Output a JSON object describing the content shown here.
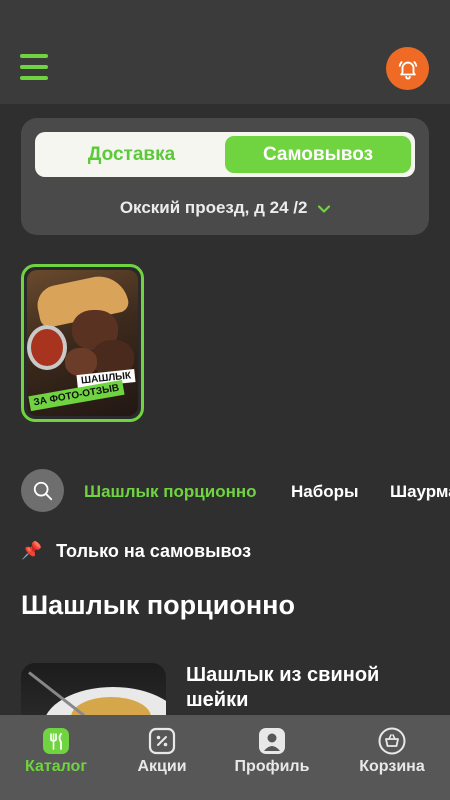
{
  "header": {
    "menu_icon": "hamburger-menu-icon",
    "bell_icon": "bell-icon",
    "accent_color": "#6fd43f",
    "bell_bg_color": "#ef6b25"
  },
  "delivery": {
    "options": [
      "Доставка",
      "Самовывоз"
    ],
    "selected": "Самовывоз",
    "address": "Окский проезд, д 24 /2"
  },
  "story": {
    "tag_top": "ШАШЛЫК",
    "tag_bottom": "ЗА ФОТО-ОТЗЫВ"
  },
  "categories": {
    "tabs": [
      "Шашлык порционно",
      "Наборы",
      "Шаурма"
    ],
    "active": "Шашлык порционно"
  },
  "pickup_note": "Только на самовывоз",
  "section_title": "Шашлык порционно",
  "products": [
    {
      "name": "Шашлык из свиной шейки"
    }
  ],
  "bottom_nav": {
    "items": [
      {
        "label": "Каталог",
        "icon": "catalog-icon"
      },
      {
        "label": "Акции",
        "icon": "promo-icon"
      },
      {
        "label": "Профиль",
        "icon": "profile-icon"
      },
      {
        "label": "Корзина",
        "icon": "basket-icon"
      }
    ],
    "active": "Каталог"
  }
}
